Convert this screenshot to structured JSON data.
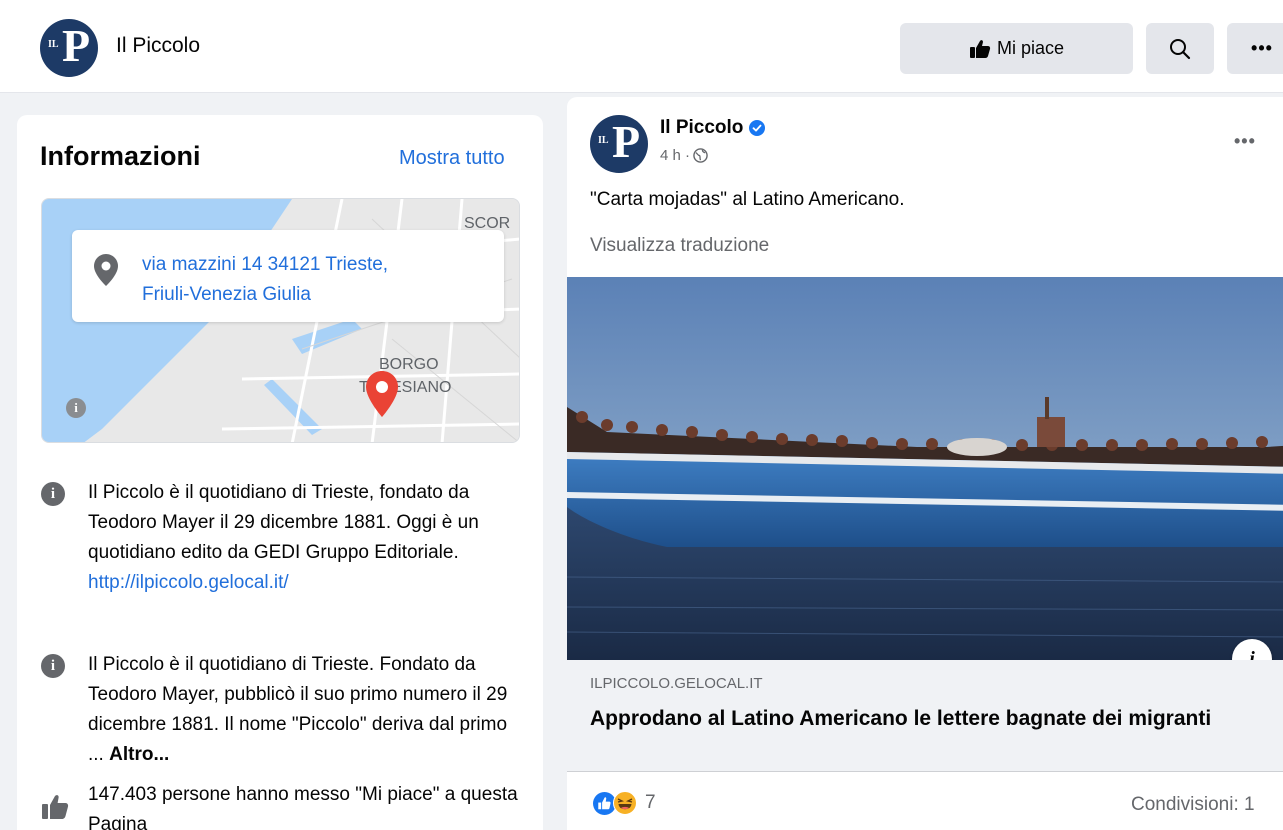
{
  "header": {
    "page_name": "Il Piccolo",
    "logo_text": "IL P",
    "like_label": "Mi piace",
    "more_label": "•••"
  },
  "about": {
    "title": "Informazioni",
    "show_all": "Mostra tutto",
    "address_line1": "via mazzini 14 34121 Trieste,",
    "address_line2": "Friuli-Venezia Giulia",
    "map_labels": [
      "SCOR",
      "BORGO",
      "TERESIANO"
    ],
    "description1": "Il Piccolo è il quotidiano di Trieste, fondato da Teodoro Mayer il 29 dicembre 1881. Oggi è un quotidiano edito da GEDI Gruppo Editoriale.",
    "website": "http://ilpiccolo.gelocal.it/",
    "description2": "Il Piccolo è il quotidiano di Trieste. Fondato da Teodoro Mayer, pubblicò il suo primo numero il 29 dicembre 1881. Il nome \"Piccolo\" deriva dal primo ...",
    "description2_more": "Altro...",
    "likes_text": "147.403 persone hanno messo \"Mi piace\" a questa Pagina"
  },
  "post": {
    "author": "Il Piccolo",
    "time": "4 h ·",
    "dots": "•••",
    "text": "\"Carta mojadas\" al Latino Americano.",
    "translate": "Visualizza traduzione",
    "link_domain": "ILPICCOLO.GELOCAL.IT",
    "link_title": "Approdano al Latino Americano le lettere bagnate dei migranti",
    "reactions_count": "7",
    "shares": "Condivisioni: 1"
  },
  "colors": {
    "link_blue": "#216fdb",
    "brand_navy": "#1d3a66",
    "fb_blue": "#1877f2"
  }
}
